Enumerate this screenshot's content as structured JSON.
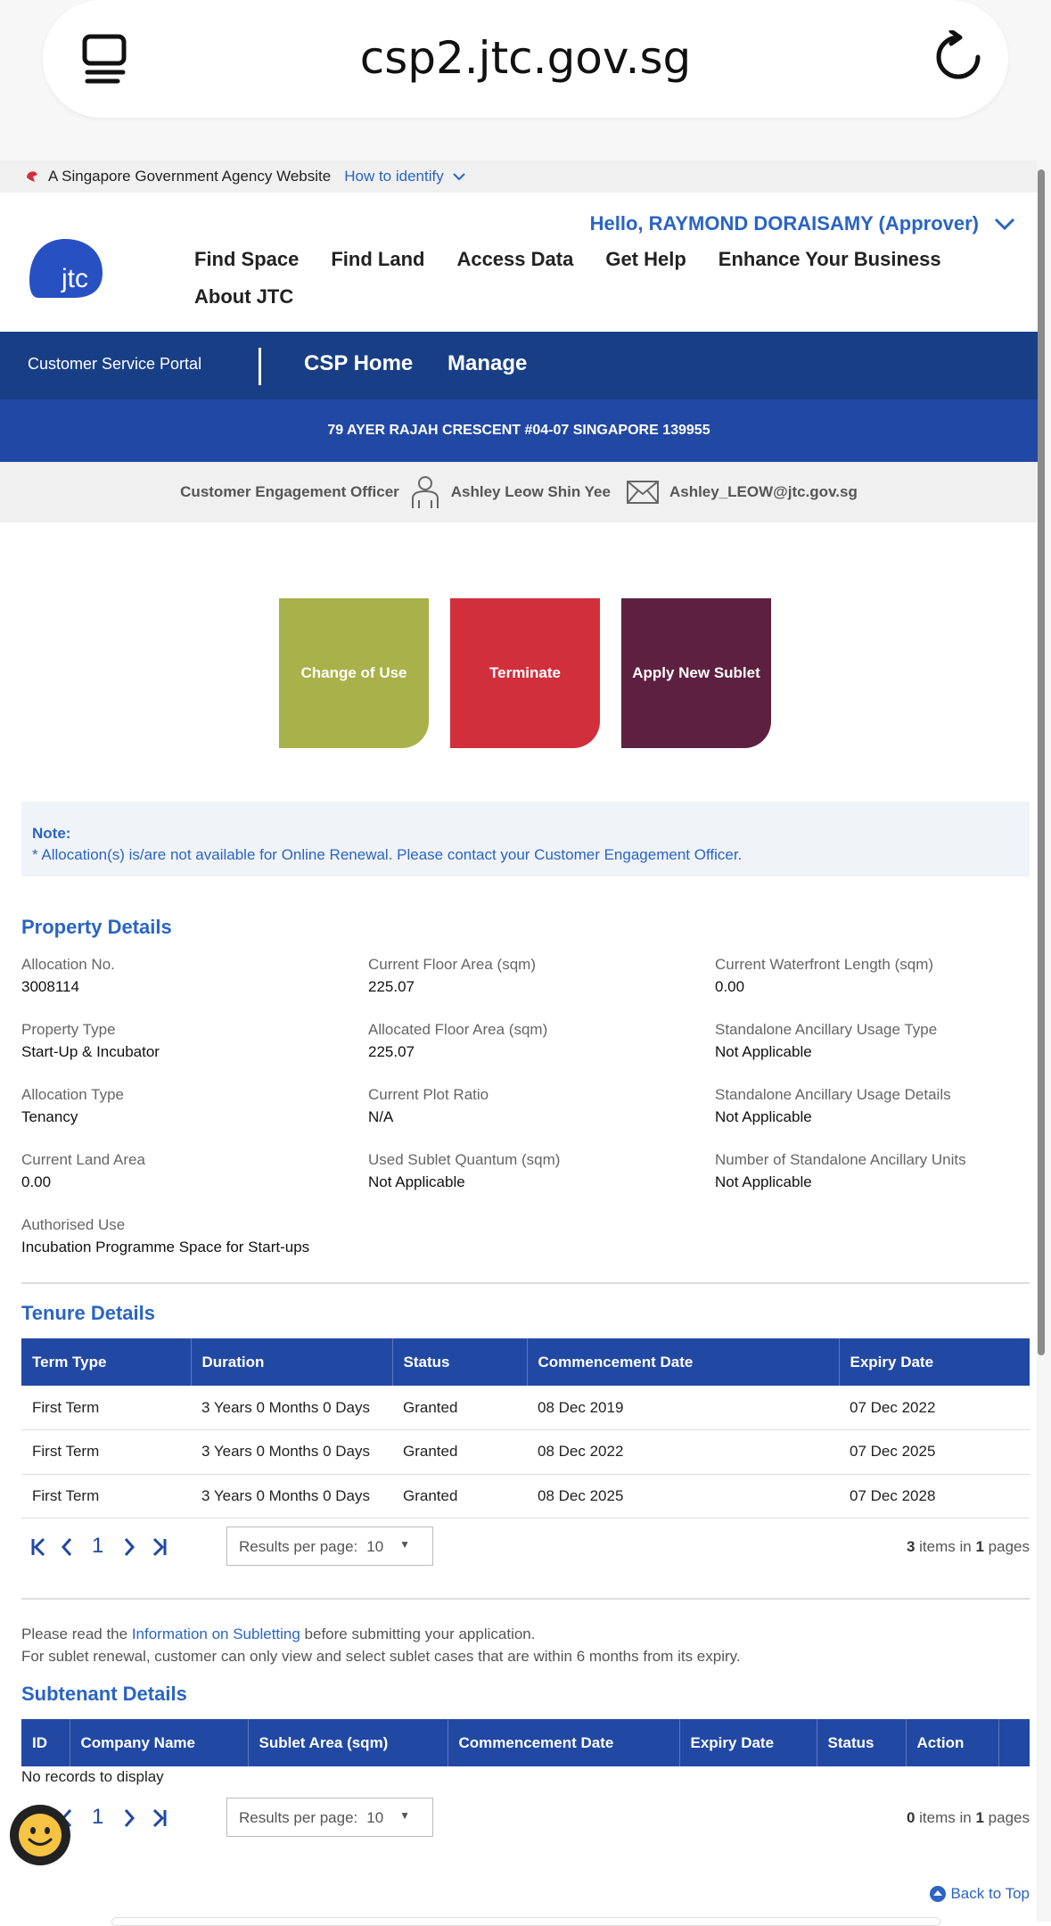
{
  "browser": {
    "url": "csp2.jtc.gov.sg"
  },
  "gov_bar": {
    "text": "A Singapore Government Agency Website",
    "how": "How to identify"
  },
  "header": {
    "greeting": "Hello, RAYMOND DORAISAMY (Approver)",
    "logo_text": "jtc",
    "nav": [
      "Find Space",
      "Find Land",
      "Access Data",
      "Get Help",
      "Enhance Your Business",
      "About JTC"
    ]
  },
  "csp": {
    "portal": "Customer Service Portal",
    "home": "CSP Home",
    "manage": "Manage"
  },
  "address": "79 AYER RAJAH CRESCENT #04-07 SINGAPORE 139955",
  "ceo": {
    "label": "Customer Engagement Officer",
    "name": "Ashley Leow Shin Yee",
    "email": "Ashley_LEOW@jtc.gov.sg"
  },
  "tiles": [
    {
      "label": "Change of Use",
      "color": "#a8b14a"
    },
    {
      "label": "Terminate",
      "color": "#d12f3c"
    },
    {
      "label": "Apply New Sublet",
      "color": "#5e2041"
    }
  ],
  "note": {
    "title": "Note:",
    "text": "* Allocation(s) is/are not available for Online Renewal. Please contact your Customer Engagement Officer."
  },
  "property": {
    "title": "Property Details",
    "fields": [
      {
        "label": "Allocation No.",
        "value": "3008114"
      },
      {
        "label": "Current Floor Area (sqm)",
        "value": "225.07"
      },
      {
        "label": "Current Waterfront Length (sqm)",
        "value": "0.00"
      },
      {
        "label": "Property Type",
        "value": "Start-Up & Incubator"
      },
      {
        "label": "Allocated Floor Area (sqm)",
        "value": "225.07"
      },
      {
        "label": "Standalone Ancillary Usage Type",
        "value": "Not Applicable"
      },
      {
        "label": "Allocation Type",
        "value": "Tenancy"
      },
      {
        "label": "Current Plot Ratio",
        "value": "N/A"
      },
      {
        "label": "Standalone Ancillary Usage Details",
        "value": "Not Applicable"
      },
      {
        "label": "Current Land Area",
        "value": "0.00"
      },
      {
        "label": "Used Sublet Quantum (sqm)",
        "value": "Not Applicable"
      },
      {
        "label": "Number of Standalone Ancillary Units",
        "value": "Not Applicable"
      },
      {
        "label": "Authorised Use",
        "value": "Incubation Programme Space for Start-ups"
      }
    ]
  },
  "tenure": {
    "title": "Tenure Details",
    "columns": [
      "Term Type",
      "Duration",
      "Status",
      "Commencement Date",
      "Expiry Date"
    ],
    "rows": [
      [
        "First Term",
        "3 Years 0 Months 0 Days",
        "Granted",
        "08 Dec 2019",
        "07 Dec 2022"
      ],
      [
        "First Term",
        "3 Years 0 Months 0 Days",
        "Granted",
        "08 Dec 2022",
        "07 Dec 2025"
      ],
      [
        "First Term",
        "3 Years 0 Months 0 Days",
        "Granted",
        "08 Dec 2025",
        "07 Dec 2028"
      ]
    ],
    "page": "1",
    "rpp_label": "Results per page:",
    "rpp_value": "10",
    "count": "3",
    "items_in": "items in",
    "pages": "1",
    "pages_word": "pages"
  },
  "info": {
    "prefix": "Please read the ",
    "link": "Information on Subletting",
    "suffix": " before submitting your application.",
    "line2": "For sublet renewal, customer can only view and select sublet cases that are within 6 months from its expiry."
  },
  "subtenant": {
    "title": "Subtenant Details",
    "columns": [
      "ID",
      "Company Name",
      "Sublet Area (sqm)",
      "Commencement Date",
      "Expiry Date",
      "Status",
      "Action"
    ],
    "empty": "No records to display",
    "page": "1",
    "rpp_label": "Results per page:",
    "rpp_value": "10",
    "count": "0",
    "items_in": "items in",
    "pages": "1",
    "pages_word": "pages"
  },
  "back_to_top": "Back to Top"
}
